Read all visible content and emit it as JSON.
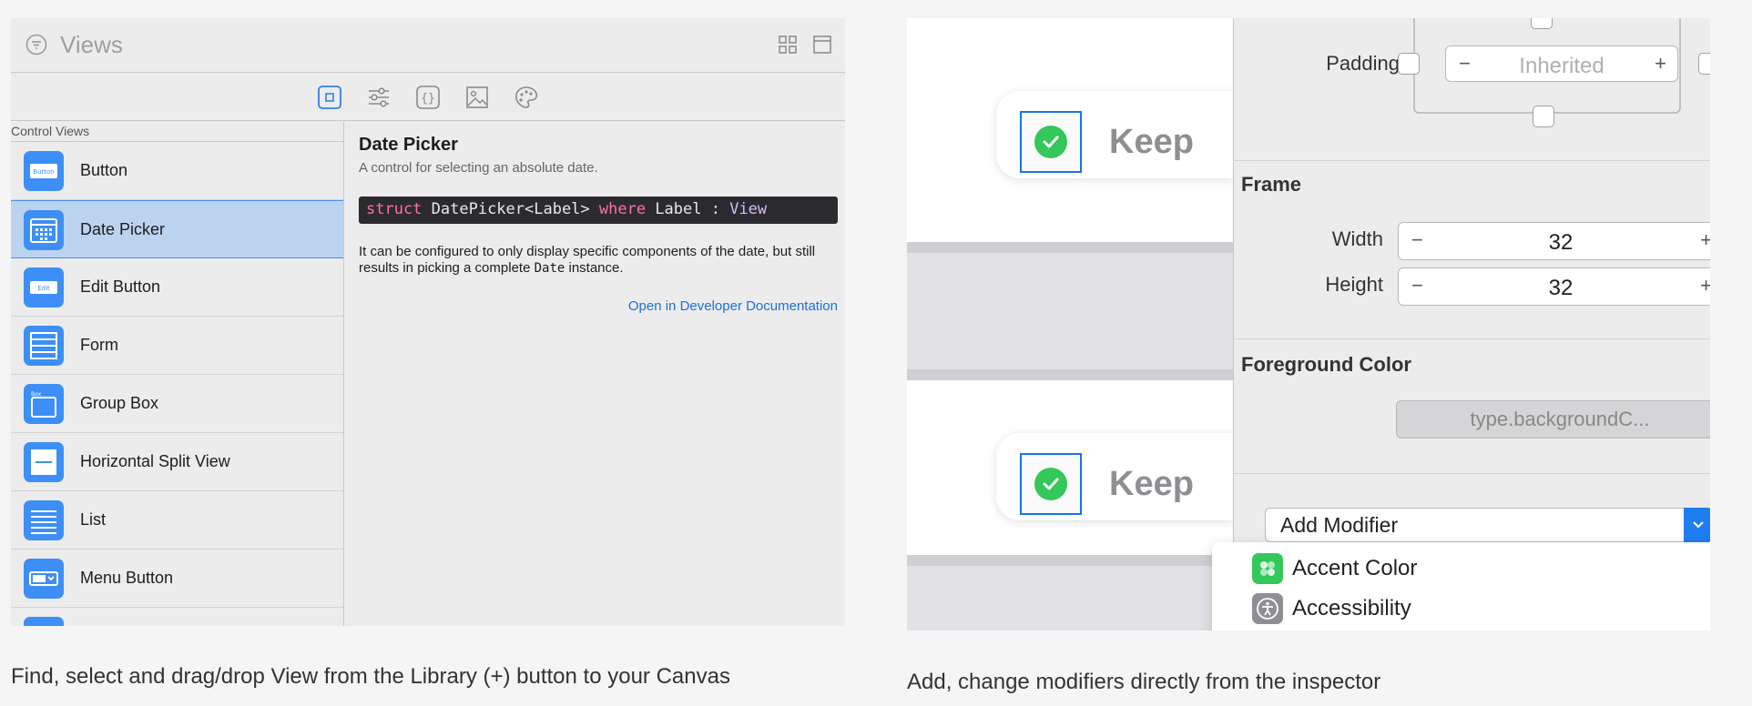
{
  "library": {
    "title": "Views",
    "list_header": "Control Views",
    "items": [
      {
        "label": "Button",
        "icon": "button-control-icon"
      },
      {
        "label": "Date Picker",
        "icon": "date-picker-icon"
      },
      {
        "label": "Edit Button",
        "icon": "edit-button-icon"
      },
      {
        "label": "Form",
        "icon": "form-icon"
      },
      {
        "label": "Group Box",
        "icon": "group-box-icon"
      },
      {
        "label": "Horizontal Split View",
        "icon": "horizontal-split-view-icon"
      },
      {
        "label": "List",
        "icon": "list-icon"
      },
      {
        "label": "Menu Button",
        "icon": "menu-button-icon"
      }
    ],
    "icon_texts": {
      "button": "Button",
      "edit": "Edit",
      "box": "Box"
    },
    "selected_index": 1,
    "detail": {
      "title": "Date Picker",
      "subtitle": "A control for selecting an absolute date.",
      "code": {
        "kw1": "struct",
        "name": " DatePicker<Label> ",
        "kw2": "where",
        "mid": " Label : ",
        "type": "View"
      },
      "desc_1": "It can be configured to only display specific components of the date, but still results in picking a complete ",
      "desc_code": "Date",
      "desc_2": " instance.",
      "link": "Open in Developer Documentation"
    },
    "accent": "#3d8ff5"
  },
  "caption_left": "Find, select and drag/drop View from the Library (+) button to your Canvas",
  "inspector": {
    "canvas": {
      "keep_label_1": "Keep",
      "keep_label_2": "Keep"
    },
    "padding": {
      "label": "Padding",
      "value": "Inherited",
      "minus": "−",
      "plus": "+"
    },
    "frame": {
      "title": "Frame",
      "width_label": "Width",
      "width_value": "32",
      "height_label": "Height",
      "height_value": "32",
      "minus": "−",
      "plus": "+"
    },
    "foreground": {
      "title": "Foreground Color",
      "value": "type.backgroundC..."
    },
    "add_modifier": "Add Modifier",
    "menu": [
      {
        "label": "Accent Color",
        "icon": "accent-color-icon",
        "color": "#34c759"
      },
      {
        "label": "Accessibility",
        "icon": "accessibility-icon",
        "color": "#8e8e93"
      }
    ]
  },
  "caption_right": "Add, change modifiers directly from the inspector"
}
